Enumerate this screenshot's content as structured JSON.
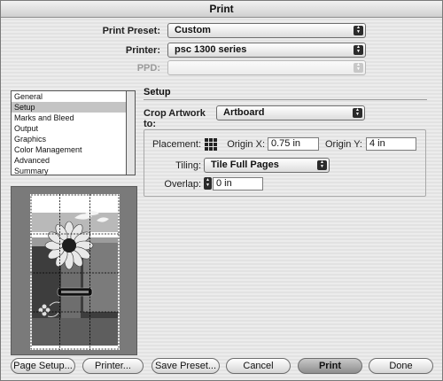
{
  "window": {
    "title": "Print"
  },
  "print_preset": {
    "label": "Print Preset:",
    "value": "Custom"
  },
  "printer": {
    "label": "Printer:",
    "value": "psc 1300 series"
  },
  "ppd": {
    "label": "PPD:",
    "value": ""
  },
  "sidebar": {
    "items": [
      {
        "label": "General",
        "selected": false
      },
      {
        "label": "Setup",
        "selected": true
      },
      {
        "label": "Marks and Bleed",
        "selected": false
      },
      {
        "label": "Output",
        "selected": false
      },
      {
        "label": "Graphics",
        "selected": false
      },
      {
        "label": "Color Management",
        "selected": false
      },
      {
        "label": "Advanced",
        "selected": false
      },
      {
        "label": "Summary",
        "selected": false
      }
    ]
  },
  "setup": {
    "title": "Setup",
    "crop_artwork": {
      "label": "Crop Artwork to:",
      "value": "Artboard"
    },
    "placement": {
      "label": "Placement:",
      "icon": "placement-grid-icon"
    },
    "origin_x": {
      "label": "Origin X:",
      "value": "0.75 in"
    },
    "origin_y": {
      "label": "Origin Y:",
      "value": "4 in"
    },
    "tiling": {
      "label": "Tiling:",
      "value": "Tile Full Pages"
    },
    "overlap": {
      "label": "Overlap:",
      "value": "0 in"
    }
  },
  "preview": {
    "tiles_columns": 3,
    "tiles_rows": 4
  },
  "buttons": {
    "page_setup": "Page Setup...",
    "printer": "Printer...",
    "save_preset": "Save Preset...",
    "cancel": "Cancel",
    "print": "Print",
    "done": "Done"
  }
}
